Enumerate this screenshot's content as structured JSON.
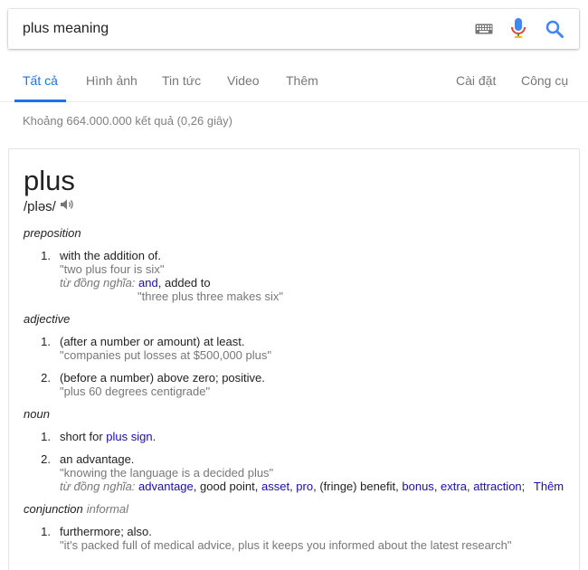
{
  "search": {
    "query": "plus meaning"
  },
  "tabs": {
    "all": "Tất cả",
    "images": "Hình ảnh",
    "news": "Tin tức",
    "video": "Video",
    "more": "Thêm",
    "settings": "Cài đặt",
    "tools": "Công cụ"
  },
  "result_stats": "Khoảng 664.000.000 kết quả (0,26 giây)",
  "dictionary": {
    "word": "plus",
    "phonetic": "/pləs/",
    "synonym_label": "từ đồng nghĩa:",
    "more_label": "Thêm",
    "preposition": {
      "pos": "preposition",
      "def1": "with the addition of.",
      "ex1": "\"two plus four is six\"",
      "syn_and": "and",
      "syn_added": ", added to",
      "ex1b": "\"three plus three makes six\""
    },
    "adjective": {
      "pos": "adjective",
      "def1": "(after a number or amount) at least.",
      "ex1": "\"companies put losses at $500,000 plus\"",
      "def2": "(before a number) above zero; positive.",
      "ex2": "\"plus 60 degrees centigrade\""
    },
    "noun": {
      "pos": "noun",
      "def1_prefix": "short for ",
      "def1_link": "plus sign",
      "def1_suffix": ".",
      "def2": "an advantage.",
      "ex2": "\"knowing the language is a decided plus\"",
      "syn": [
        "advantage",
        "good point",
        "asset",
        "pro",
        "(fringe) benefit",
        "bonus",
        "extra",
        "attraction"
      ]
    },
    "conjunction": {
      "pos": "conjunction",
      "register": "informal",
      "def1": "furthermore; also.",
      "ex1": "\"it's packed full of medical advice, plus it keeps you informed about the latest research\""
    },
    "numbers": [
      "1.",
      "2."
    ]
  },
  "colors": {
    "accent": "#1a73e8",
    "link": "#1a0dab",
    "muted": "#777777"
  }
}
